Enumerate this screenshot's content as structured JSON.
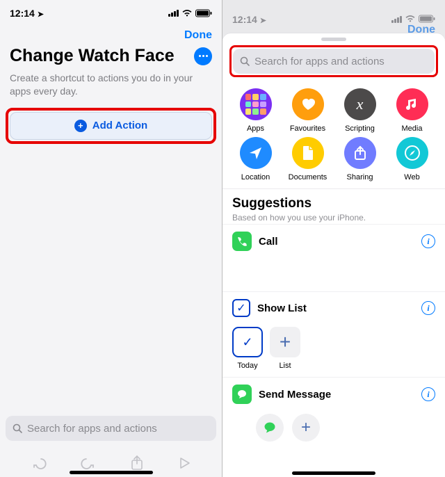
{
  "status": {
    "time": "12:14",
    "loc_arrow": "➤"
  },
  "left": {
    "done": "Done",
    "title": "Change Watch Face",
    "desc": "Create a shortcut to actions you do in your apps every day.",
    "add_action": "Add Action",
    "search_placeholder": "Search for apps and actions"
  },
  "right": {
    "fake_done": "Done",
    "search_placeholder": "Search for apps and actions",
    "categories": [
      {
        "id": "apps",
        "label": "Apps"
      },
      {
        "id": "favourites",
        "label": "Favourites"
      },
      {
        "id": "scripting",
        "label": "Scripting"
      },
      {
        "id": "media",
        "label": "Media"
      },
      {
        "id": "location",
        "label": "Location"
      },
      {
        "id": "documents",
        "label": "Documents"
      },
      {
        "id": "sharing",
        "label": "Sharing"
      },
      {
        "id": "web",
        "label": "Web"
      }
    ],
    "suggestions": {
      "title": "Suggestions",
      "subtitle": "Based on how you use your iPhone.",
      "items": [
        {
          "id": "call",
          "label": "Call"
        },
        {
          "id": "showlist",
          "label": "Show List",
          "chips": [
            {
              "id": "today",
              "label": "Today"
            },
            {
              "id": "list",
              "label": "List"
            }
          ]
        },
        {
          "id": "sendmsg",
          "label": "Send Message"
        }
      ]
    }
  }
}
